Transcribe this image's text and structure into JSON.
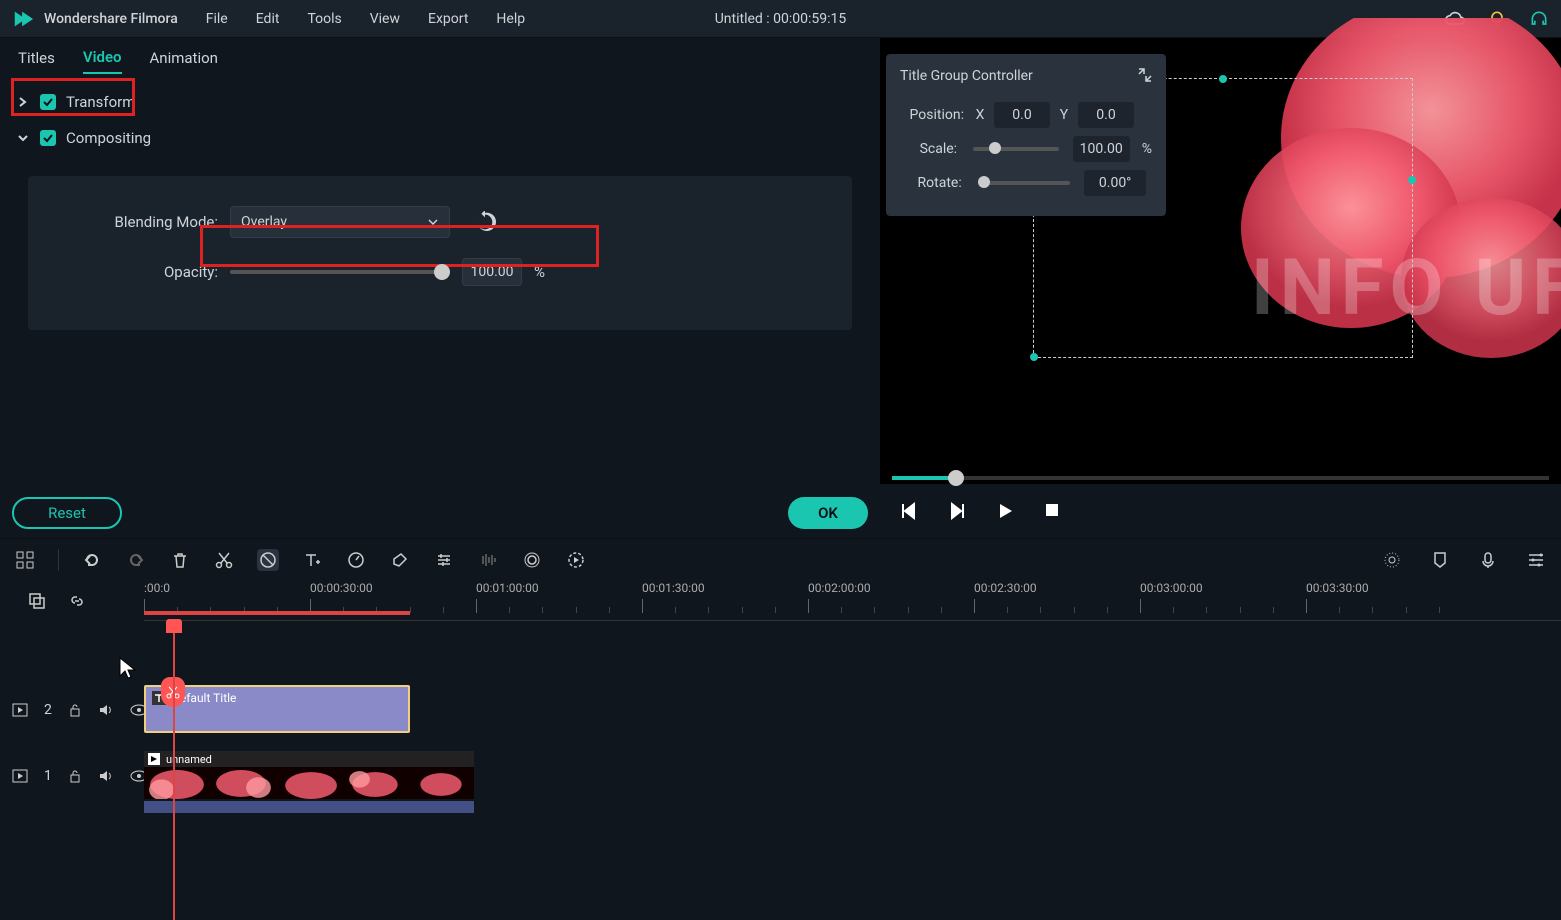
{
  "app": {
    "name": "Wondershare Filmora"
  },
  "menu": {
    "file": "File",
    "edit": "Edit",
    "tools": "Tools",
    "view": "View",
    "export": "Export",
    "help": "Help"
  },
  "title_center": "Untitled : 00:00:59:15",
  "tabs": {
    "titles": "Titles",
    "video": "Video",
    "animation": "Animation"
  },
  "sections": {
    "transform": "Transform",
    "compositing": "Compositing"
  },
  "compositing": {
    "blend_label": "Blending Mode:",
    "blend_value": "Overlay",
    "opacity_label": "Opacity:",
    "opacity_value": "100.00",
    "opacity_unit": "%"
  },
  "buttons": {
    "reset": "Reset",
    "ok": "OK"
  },
  "title_group": {
    "heading": "Title Group Controller",
    "position_label": "Position:",
    "x_label": "X",
    "x_value": "0.0",
    "y_label": "Y",
    "y_value": "0.0",
    "scale_label": "Scale:",
    "scale_value": "100.00",
    "scale_unit": "%",
    "rotate_label": "Rotate:",
    "rotate_value": "0.00°"
  },
  "preview_text": "INFO UF",
  "ruler_labels": [
    ":00:0",
    "00:00:30:00",
    "00:01:00:00",
    "00:01:30:00",
    "00:02:00:00",
    "00:02:30:00",
    "00:03:00:00",
    "00:03:30:00"
  ],
  "tracks": {
    "t2_index": "2",
    "t1_index": "1",
    "clip_title_name": "Default Title",
    "clip_video_name": "unnamed"
  }
}
